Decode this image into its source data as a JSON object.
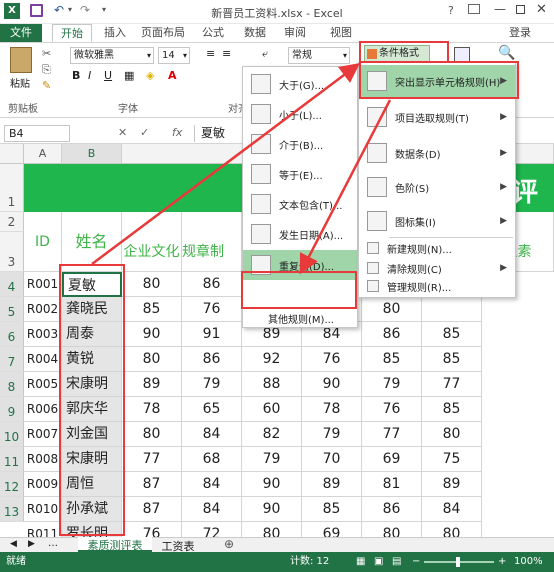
{
  "title": "新晋员工资料.xlsx - Excel",
  "help": "?",
  "signin": "登录",
  "tabs": [
    "文件",
    "开始",
    "插入",
    "页面布局",
    "公式",
    "数据",
    "审阅",
    "视图"
  ],
  "ribbon": {
    "font": "微软雅黑",
    "size": "14",
    "number_format": "常规",
    "cond_format": "条件格式",
    "groups": [
      "剪贴板",
      "字体",
      "对齐方式"
    ],
    "paste": "粘贴"
  },
  "namebox": "B4",
  "formula_value": "夏敏",
  "fx": "fx",
  "columns": [
    "A",
    "B"
  ],
  "rows": [
    "1",
    "2",
    "3",
    "4",
    "5",
    "6",
    "7",
    "8",
    "9",
    "10",
    "11",
    "12",
    "13"
  ],
  "header_row": {
    "id": "ID",
    "name": "姓名",
    "c": "企业文化",
    "d": "规章制",
    "right": "义素",
    "title_char": "评"
  },
  "data": [
    {
      "id": "R001",
      "name": "夏敏",
      "c": "80",
      "d": "86",
      "e": "",
      "f": "",
      "g": "",
      "h": "76"
    },
    {
      "id": "R002",
      "name": "龚晓民",
      "c": "85",
      "d": "76",
      "e": "83",
      "f": "87",
      "g": "80",
      "h": ""
    },
    {
      "id": "R003",
      "name": "周泰",
      "c": "90",
      "d": "91",
      "e": "89",
      "f": "84",
      "g": "86",
      "h": "85"
    },
    {
      "id": "R004",
      "name": "黄锐",
      "c": "80",
      "d": "86",
      "e": "92",
      "f": "76",
      "g": "85",
      "h": "85"
    },
    {
      "id": "R005",
      "name": "宋康明",
      "c": "89",
      "d": "79",
      "e": "88",
      "f": "90",
      "g": "79",
      "h": "77"
    },
    {
      "id": "R006",
      "name": "郭庆华",
      "c": "78",
      "d": "65",
      "e": "60",
      "f": "78",
      "g": "76",
      "h": "85"
    },
    {
      "id": "R007",
      "name": "刘金国",
      "c": "80",
      "d": "84",
      "e": "82",
      "f": "79",
      "g": "77",
      "h": "80"
    },
    {
      "id": "R008",
      "name": "宋康明",
      "c": "77",
      "d": "68",
      "e": "79",
      "f": "70",
      "g": "69",
      "h": "75"
    },
    {
      "id": "R009",
      "name": "周恒",
      "c": "87",
      "d": "84",
      "e": "90",
      "f": "89",
      "g": "81",
      "h": "89"
    },
    {
      "id": "R010",
      "name": "孙承斌",
      "c": "87",
      "d": "84",
      "e": "90",
      "f": "85",
      "g": "86",
      "h": "84"
    },
    {
      "id": "R011",
      "name": "罗长明",
      "c": "76",
      "d": "72",
      "e": "80",
      "f": "69",
      "g": "80",
      "h": "80"
    }
  ],
  "menu_main": [
    {
      "label": "突出显示单元格规则(H)",
      "icon": "highlight-rules-icon"
    },
    {
      "label": "项目选取规则(T)",
      "icon": "top-bottom-icon"
    },
    {
      "label": "数据条(D)",
      "icon": "databars-icon"
    },
    {
      "label": "色阶(S)",
      "icon": "colorscale-icon"
    },
    {
      "label": "图标集(I)",
      "icon": "iconsets-icon"
    },
    {
      "label": "新建规则(N)...",
      "icon": "new-rule-icon"
    },
    {
      "label": "清除规则(C)",
      "icon": "clear-rules-icon"
    },
    {
      "label": "管理规则(R)...",
      "icon": "manage-rules-icon"
    }
  ],
  "menu_sub": [
    {
      "label": "大于(G)..."
    },
    {
      "label": "小于(L)..."
    },
    {
      "label": "介于(B)..."
    },
    {
      "label": "等于(E)..."
    },
    {
      "label": "文本包含(T)..."
    },
    {
      "label": "发生日期(A)..."
    },
    {
      "label": "重复值(D)..."
    },
    {
      "label": "其他规则(M)..."
    }
  ],
  "sheets": [
    "素质测评表",
    "工资表"
  ],
  "status": {
    "ready": "就绪",
    "count": "计数: 12",
    "zoom": "100%"
  },
  "colors": {
    "excel_green": "#217346",
    "title_green": "#1fb64e",
    "header_text": "#3fb449",
    "highlight": "#e5e5e5",
    "red": "#e83a3a"
  }
}
